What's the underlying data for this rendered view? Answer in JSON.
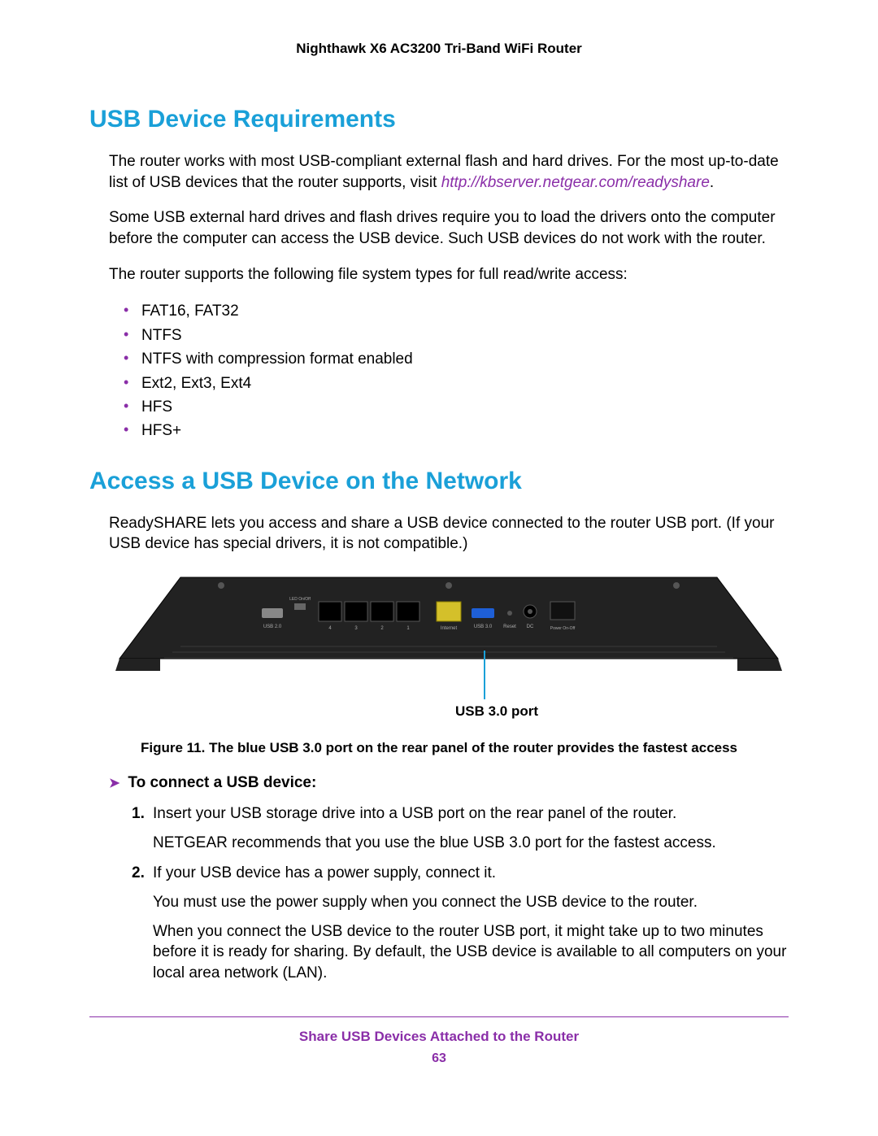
{
  "header": {
    "title": "Nighthawk X6 AC3200 Tri-Band WiFi Router"
  },
  "section1": {
    "heading": "USB Device Requirements",
    "para1_a": "The router works with most USB-compliant external flash and hard drives. For the most up-to-date list of USB devices that the router supports, visit ",
    "para1_link": "http://kbserver.netgear.com/readyshare",
    "para1_b": ".",
    "para2": "Some USB external hard drives and flash drives require you to load the drivers onto the computer before the computer can access the USB device. Such USB devices do not work with the router.",
    "para3": "The router supports the following file system types for full read/write access:",
    "fs_list": [
      "FAT16, FAT32",
      "NTFS",
      "NTFS with compression format enabled",
      "Ext2, Ext3, Ext4",
      "HFS",
      "HFS+"
    ]
  },
  "section2": {
    "heading": "Access a USB Device on the Network",
    "para1": "ReadySHARE lets you access and share a USB device connected to the router USB port. (If your USB device has special drivers, it is not compatible.)",
    "callout_label": "USB 3.0 port",
    "figure_caption": "Figure 11. The blue USB 3.0 port on the rear panel of the router provides the fastest access",
    "task_heading": "To connect a USB device:",
    "steps": [
      {
        "lead": "Insert your USB storage drive into a USB port on the rear panel of the router.",
        "extra": [
          "NETGEAR recommends that you use the blue USB 3.0 port for the fastest access."
        ]
      },
      {
        "lead": "If your USB device has a power supply, connect it.",
        "extra": [
          "You must use the power supply when you connect the USB device to the router.",
          "When you connect the USB device to the router USB port, it might take up to two minutes before it is ready for sharing. By default, the USB device is available to all computers on your local area network (LAN)."
        ]
      }
    ],
    "router_labels": {
      "led": "LED On/Off",
      "usb2": "USB 2.0",
      "lan4": "4",
      "lan3": "3",
      "lan2": "2",
      "lan1": "1",
      "internet": "Internet",
      "usb3": "USB 3.0",
      "reset": "Reset",
      "dc": "DC",
      "power": "Power On-Off"
    }
  },
  "footer": {
    "chapter": "Share USB Devices Attached to the Router",
    "page_number": "63"
  }
}
